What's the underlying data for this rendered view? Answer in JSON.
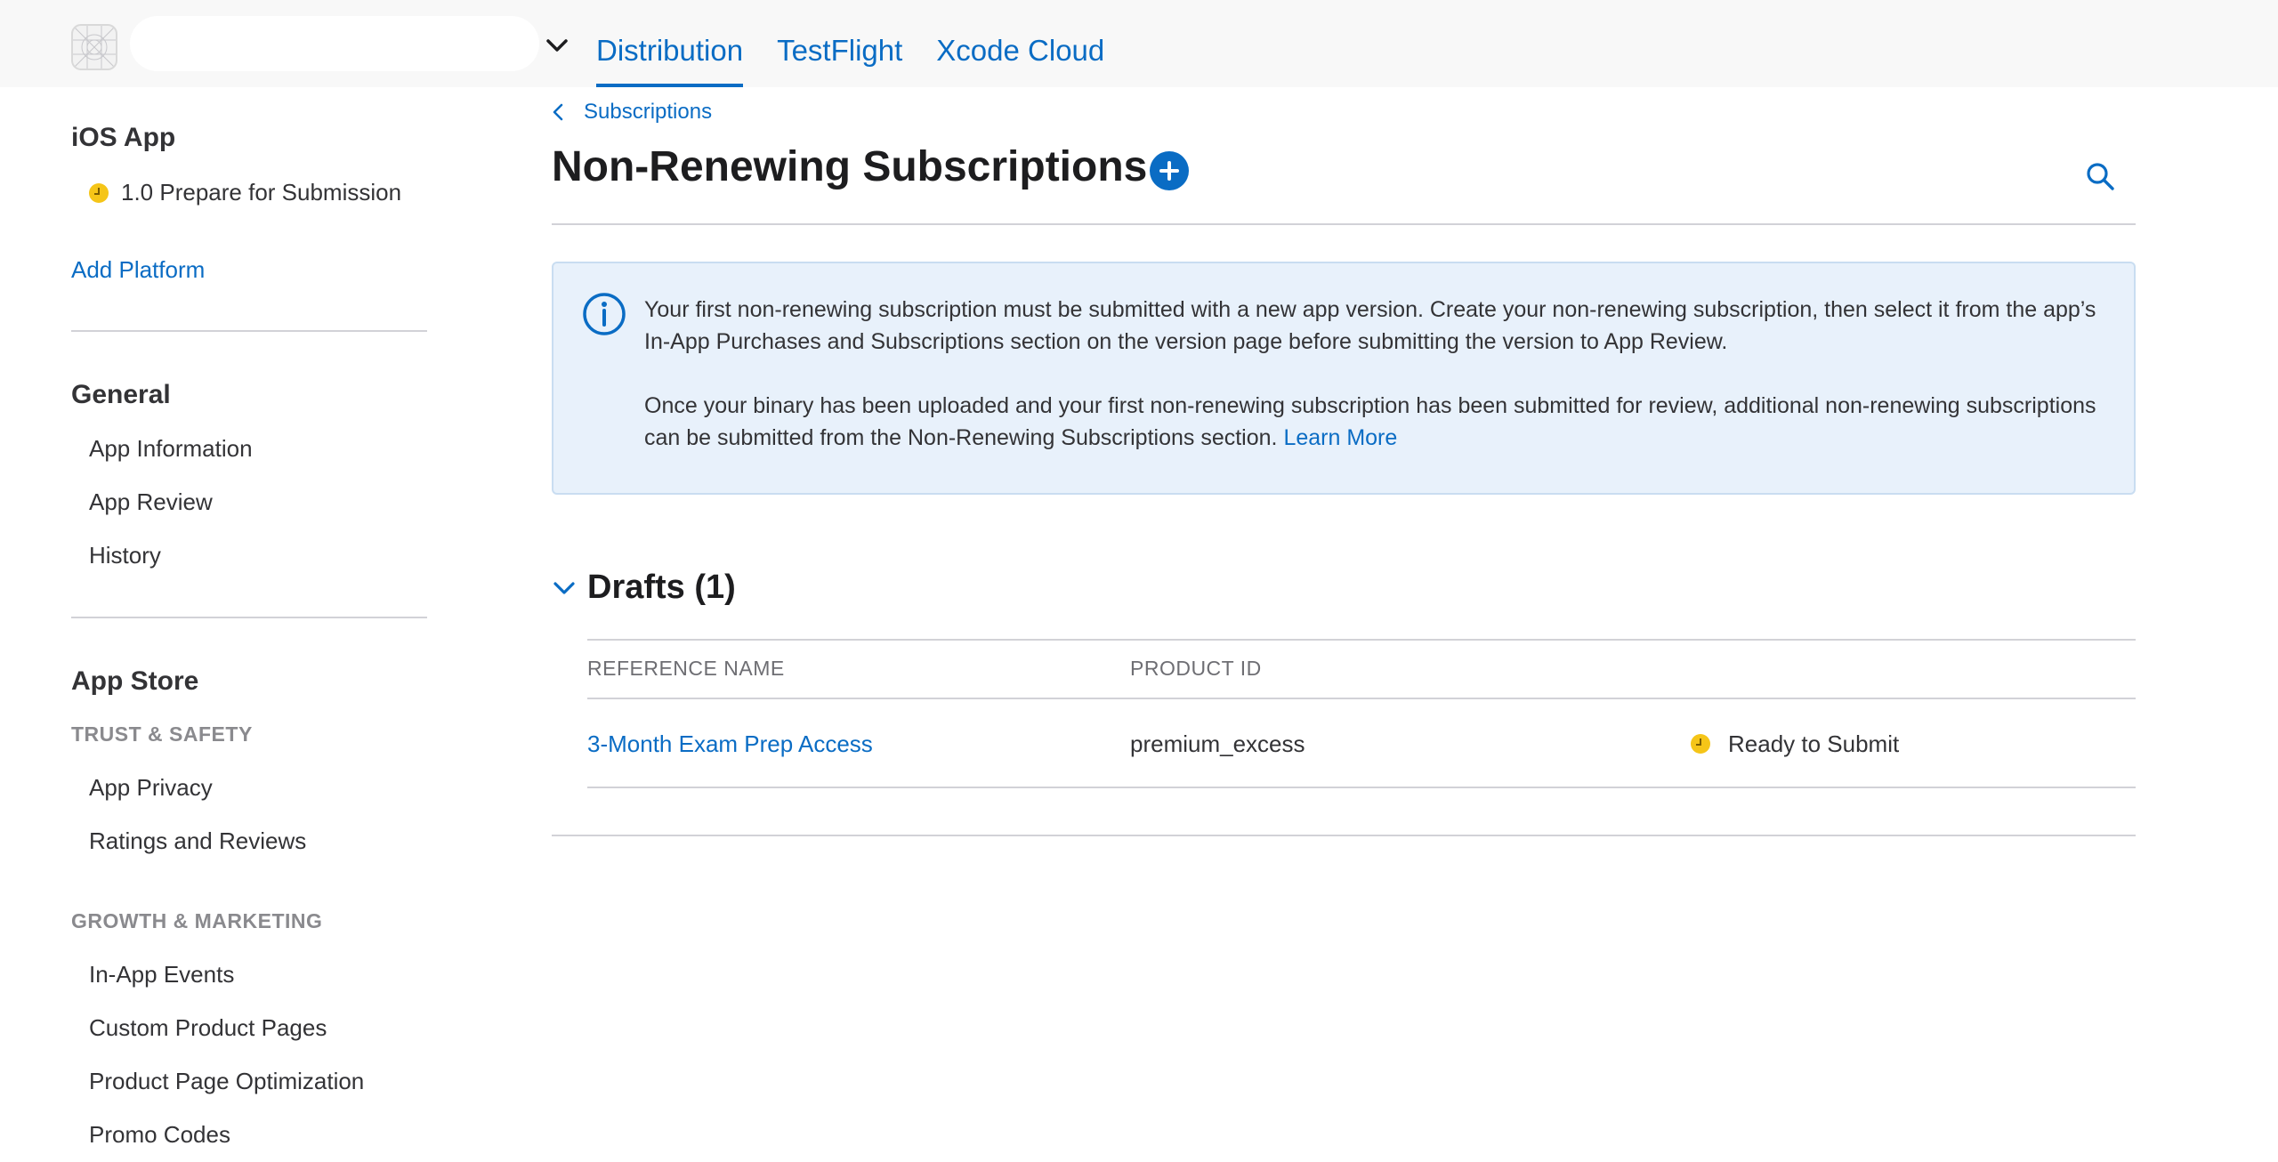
{
  "header": {
    "tabs": [
      {
        "label": "Distribution",
        "active": true
      },
      {
        "label": "TestFlight",
        "active": false
      },
      {
        "label": "Xcode Cloud",
        "active": false
      }
    ],
    "accent_color": "#0a6cc4"
  },
  "sidebar": {
    "platform_title": "iOS App",
    "version_label": "1.0 Prepare for Submission",
    "add_platform": "Add Platform",
    "general": {
      "title": "General",
      "items": [
        "App Information",
        "App Review",
        "History"
      ]
    },
    "app_store": {
      "title": "App Store",
      "trust_caption": "TRUST & SAFETY",
      "trust_items": [
        "App Privacy",
        "Ratings and Reviews"
      ],
      "growth_caption": "GROWTH & MARKETING",
      "growth_items": [
        "In-App Events",
        "Custom Product Pages",
        "Product Page Optimization",
        "Promo Codes"
      ]
    }
  },
  "main": {
    "breadcrumb": "Subscriptions",
    "title": "Non-Renewing Subscriptions",
    "info": {
      "paragraph1": "Your first non-renewing subscription must be submitted with a new app version. Create your non-renewing subscription, then select it from the app’s In-App Purchases and Subscriptions section on the version page before submitting the version to App Review.",
      "paragraph2": "Once your binary has been uploaded and your first non-renewing subscription has been submitted for review, additional non-renewing subscriptions can be submitted from the Non-Renewing Subscriptions section.",
      "learn_more": "Learn More"
    },
    "drafts": {
      "title": "Drafts (1)",
      "columns": [
        "REFERENCE NAME",
        "PRODUCT ID"
      ],
      "rows": [
        {
          "reference_name": "3-Month Exam Prep Access",
          "product_id": "premium_excess",
          "status": "Ready to Submit"
        }
      ]
    }
  },
  "icons": [
    "app-icon",
    "chevron-down-icon",
    "chevron-left-icon",
    "plus-icon",
    "search-icon",
    "info-icon",
    "clock-icon"
  ],
  "status_color": "#f5c518"
}
